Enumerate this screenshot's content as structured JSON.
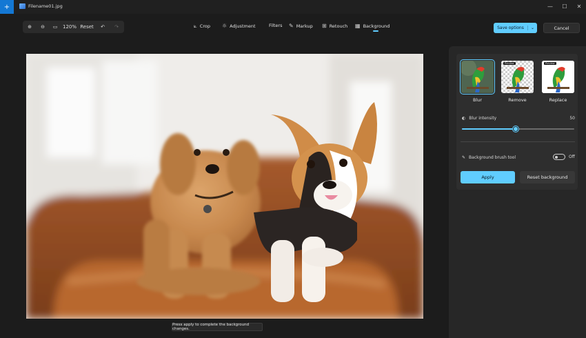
{
  "titlebar": {
    "file_name": "Filename01.jpg",
    "minimize": "—",
    "maximize": "☐",
    "close": "✕",
    "app_icon": "+"
  },
  "toolbar": {
    "zoom_in_icon": "⊕",
    "zoom_out_icon": "⊖",
    "fit_icon": "▭",
    "zoom_level": "120%",
    "reset_label": "Reset",
    "undo_icon": "↶",
    "redo_icon": "↷",
    "tools": [
      {
        "label": "Crop",
        "icon": "⟀"
      },
      {
        "label": "Adjustment",
        "icon": "☼"
      },
      {
        "label": "Filters",
        "icon": ""
      },
      {
        "label": "Markup",
        "icon": "✎"
      },
      {
        "label": "Retouch",
        "icon": "⊞"
      },
      {
        "label": "Background",
        "icon": "▦"
      }
    ],
    "active_tool": "Background",
    "save_label": "Save options",
    "save_chevron": "⌄",
    "cancel_label": "Cancel"
  },
  "canvas": {
    "tooltip": "Press apply to complete the background changes."
  },
  "panel": {
    "modes": [
      {
        "label": "Blur",
        "selected": true,
        "badge": ""
      },
      {
        "label": "Remove",
        "selected": false,
        "badge": "Preview"
      },
      {
        "label": "Replace",
        "selected": false,
        "badge": "Preview"
      }
    ],
    "blur_icon": "◐",
    "blur_label": "Blur intensity",
    "blur_value": "50",
    "blur_fraction": 0.48,
    "brush_icon": "✎",
    "brush_label": "Background brush tool",
    "brush_state": "Off",
    "apply_label": "Apply",
    "reset_label": "Reset background"
  },
  "colors": {
    "accent": "#60cdff",
    "app_icon_bg": "#1478d4",
    "background": "#1c1c1c",
    "panel": "#272727"
  }
}
